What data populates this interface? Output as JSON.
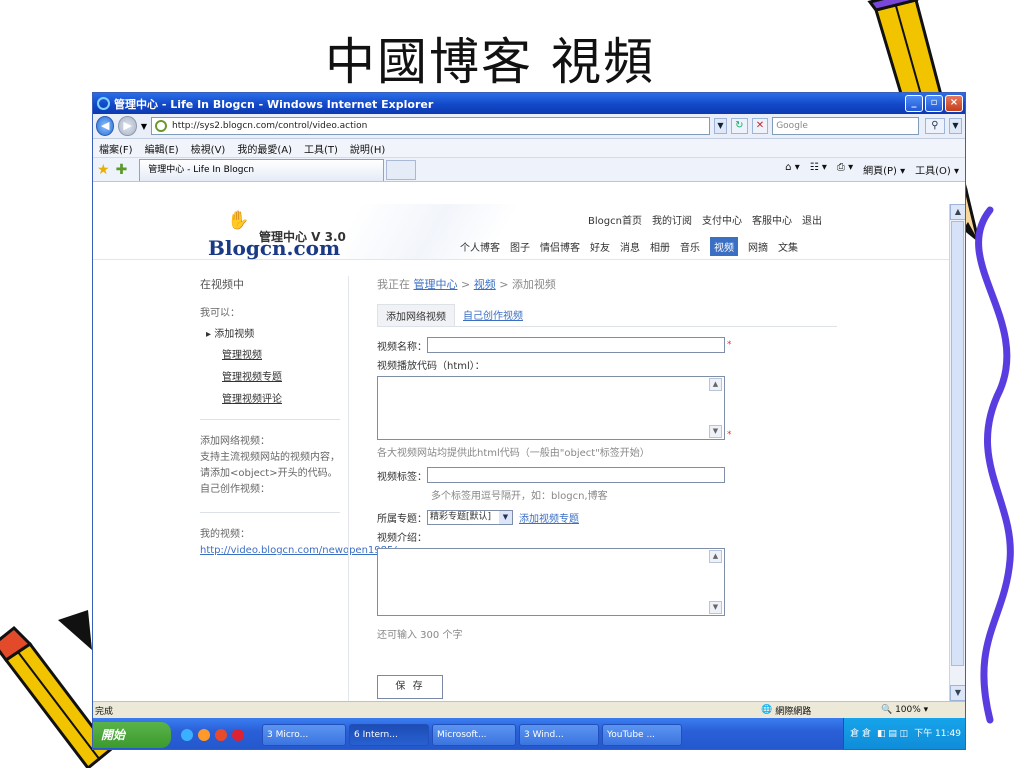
{
  "slide": {
    "title": "中國博客 視頻"
  },
  "window": {
    "title": "管理中心 - Life In Blogcn - Windows Internet Explorer",
    "address": "http://sys2.blogcn.com/control/video.action",
    "search_placeholder": "Google",
    "menu": [
      "檔案(F)",
      "編輯(E)",
      "檢視(V)",
      "我的最愛(A)",
      "工具(T)",
      "說明(H)"
    ],
    "tab_title": "管理中心 - Life In Blogcn",
    "command_bar": [
      "網頁(P) ▾",
      "工具(O) ▾"
    ]
  },
  "site": {
    "logo_text": "管理中心 V 3.0",
    "logo_brand": "Blogcn.com",
    "top_links": [
      "Blogcn首页",
      "我的订阅",
      "支付中心",
      "客服中心",
      "退出"
    ],
    "nav": [
      "个人博客",
      "图子",
      "情侣博客",
      "好友",
      "消息",
      "相册",
      "音乐",
      "视频",
      "网摘",
      "文集"
    ],
    "nav_active": "视频"
  },
  "sidebar": {
    "heading": "在视频中",
    "can_label": "我可以：",
    "current": "▸ 添加视频",
    "links": [
      "管理视频",
      "管理视频专题",
      "管理视频评论"
    ],
    "add_net_title": "添加网络视频：",
    "add_net_desc": "支持主流视频网站的视频内容，请添加<object>开头的代码。",
    "self_made": "自己创作视频：",
    "my_video_label": "我的视频：",
    "my_video_url": "http://video.blogcn.com/newopen1985/"
  },
  "main": {
    "crumb_prefix": "我正在",
    "crumb": [
      "管理中心",
      "视频",
      "添加视频"
    ],
    "tabs": [
      "添加网络视频",
      "自己创作视频"
    ],
    "name_label": "视频名称：",
    "code_label": "视频播放代码（html）：",
    "code_hint": "各大视频网站均提供此html代码（一般由\"object\"标签开始）",
    "tag_label": "视频标签：",
    "tag_hint": "多个标签用逗号隔开，如：blogcn,博客",
    "topic_label": "所属专题：",
    "topic_value": "精彩专题[默认]",
    "add_topic": "添加视频专题",
    "intro_label": "视频介绍：",
    "remain": "还可输入 300 个字",
    "save": "保 存"
  },
  "status": {
    "text": "完成",
    "zone": "網際網路",
    "zoom": "100%"
  },
  "taskbar": {
    "start": "開始",
    "buttons": [
      "3 Micro...",
      "6 Intern...",
      "Microsoft...",
      "3 Wind...",
      "YouTube ..."
    ],
    "clock": "下午 11:49"
  }
}
